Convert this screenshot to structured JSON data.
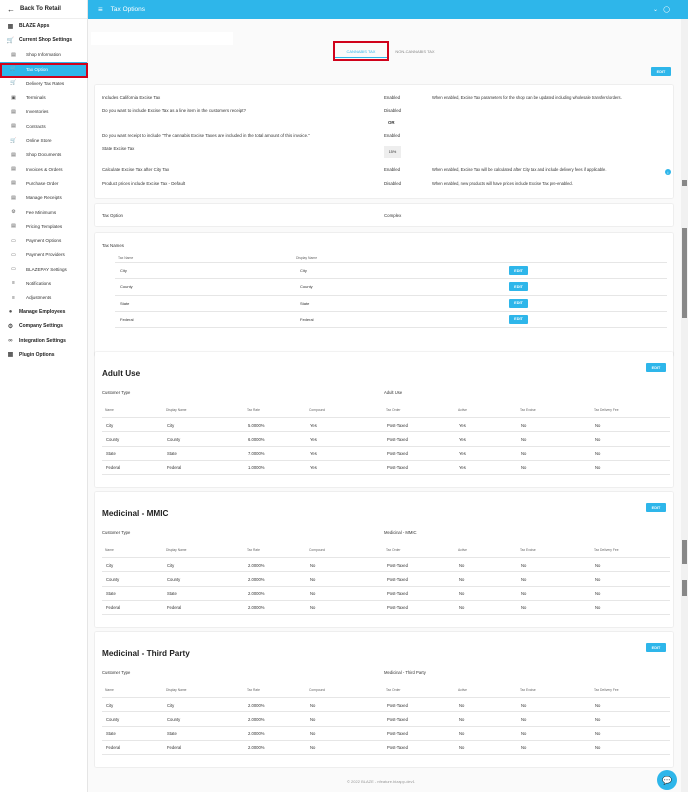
{
  "sidebar": {
    "back": "Back To Retail",
    "items": [
      {
        "label": "BLAZE Apps",
        "icon": "grid-icon",
        "glyph": "▦",
        "level": "top"
      },
      {
        "label": "Current Shop Settings",
        "icon": "cart-icon",
        "glyph": "🛒",
        "level": "top"
      },
      {
        "label": "Shop Information",
        "icon": "store-icon",
        "glyph": "▤",
        "level": "sub"
      },
      {
        "label": "Tax Option",
        "icon": "cart-icon",
        "glyph": "🛒",
        "level": "sub",
        "active": true
      },
      {
        "label": "Delivery Tax Rates",
        "icon": "cart-icon",
        "glyph": "🛒",
        "level": "sub"
      },
      {
        "label": "Terminals",
        "icon": "briefcase-icon",
        "glyph": "▣",
        "level": "sub"
      },
      {
        "label": "Inventories",
        "icon": "document-icon",
        "glyph": "▤",
        "level": "sub"
      },
      {
        "label": "Contracts",
        "icon": "document-icon",
        "glyph": "▤",
        "level": "sub"
      },
      {
        "label": "Online Store",
        "icon": "cart-icon",
        "glyph": "🛒",
        "level": "sub"
      },
      {
        "label": "Shop Documents",
        "icon": "document-icon",
        "glyph": "▤",
        "level": "sub"
      },
      {
        "label": "Invoices & Orders",
        "icon": "document-icon",
        "glyph": "▤",
        "level": "sub"
      },
      {
        "label": "Purchase Order",
        "icon": "document-icon",
        "glyph": "▤",
        "level": "sub"
      },
      {
        "label": "Manage Receipts",
        "icon": "document-icon",
        "glyph": "▤",
        "level": "sub"
      },
      {
        "label": "Fee Minimums",
        "icon": "gear-icon",
        "glyph": "⚙",
        "level": "sub"
      },
      {
        "label": "Pricing Templates",
        "icon": "document-icon",
        "glyph": "▤",
        "level": "sub"
      },
      {
        "label": "Payment Options",
        "icon": "card-icon",
        "glyph": "▭",
        "level": "sub"
      },
      {
        "label": "Payment Providers",
        "icon": "card-icon",
        "glyph": "▭",
        "level": "sub"
      },
      {
        "label": "BLAZEPAY Settings",
        "icon": "card-icon",
        "glyph": "▭",
        "level": "sub"
      },
      {
        "label": "Notifications",
        "icon": "list-icon",
        "glyph": "≡",
        "level": "sub"
      },
      {
        "label": "Adjustments",
        "icon": "list-icon",
        "glyph": "≡",
        "level": "sub"
      },
      {
        "label": "Manage Employees",
        "icon": "person-icon",
        "glyph": "●",
        "level": "top"
      },
      {
        "label": "Company Settings",
        "icon": "gear-icon",
        "glyph": "⚙",
        "level": "top"
      },
      {
        "label": "Integration Settings",
        "icon": "link-icon",
        "glyph": "∞",
        "level": "top"
      },
      {
        "label": "Plugin Options",
        "icon": "grid-icon",
        "glyph": "▦",
        "level": "top"
      }
    ]
  },
  "header": {
    "title": "Tax Options"
  },
  "tabs": [
    "CANNABIS TAX",
    "NON-CANNABIS TAX"
  ],
  "edit_label": "EDIT",
  "settings": {
    "rows": [
      {
        "label": "Includes California Excise Tax",
        "value": "Enabled",
        "desc": "When enabled, Excise Tax parameters for the shop can be updated including wholesale transfers/orders."
      },
      {
        "label": "Do you want to include Excise Tax as a line item in the customers receipt?",
        "value": "Disabled",
        "desc": ""
      },
      {
        "label": "",
        "value": "OR",
        "desc": ""
      },
      {
        "label": "Do you want receipt to include \"The cannabis Excise Taxes are included in the total amount of this invoice.\"",
        "value": "Enabled",
        "desc": ""
      },
      {
        "label": "State Excise Tax",
        "value": "15%",
        "desc": ""
      },
      {
        "label": "Calculate Excise Tax after City Tax",
        "value": "Enabled",
        "desc": "When enabled, Excise Tax will be calculated after City tax and include delivery fees if applicable."
      },
      {
        "label": "Product prices include Excise Tax - Default",
        "value": "Disabled",
        "desc": "When enabled, new products will have prices include Excise Tax pre-enabled."
      }
    ]
  },
  "tax_option": {
    "label": "Tax Option",
    "value": "Complex"
  },
  "tax_names": {
    "title": "Tax Names",
    "headers": [
      "Tax Name",
      "Display Name"
    ],
    "rows": [
      [
        "City",
        "City"
      ],
      [
        "County",
        "County"
      ],
      [
        "State",
        "State"
      ],
      [
        "Federal",
        "Federal"
      ]
    ]
  },
  "tax_tables": [
    {
      "title": "Adult Use",
      "customer_type_label": "Customer Type",
      "customer_type": "Adult Use",
      "headers": [
        "Name",
        "Display Name",
        "Tax Rate",
        "Compound",
        "Tax Order",
        "Active",
        "Tax Excise",
        "Tax Delivery Fee"
      ],
      "rows": [
        [
          "City",
          "City",
          "5.0000%",
          "Yes",
          "Post-Taxed",
          "Yes",
          "No",
          "No"
        ],
        [
          "County",
          "County",
          "6.0000%",
          "Yes",
          "Post-Taxed",
          "Yes",
          "No",
          "No"
        ],
        [
          "State",
          "State",
          "7.0000%",
          "Yes",
          "Post-Taxed",
          "Yes",
          "No",
          "No"
        ],
        [
          "Federal",
          "Federal",
          "1.0000%",
          "Yes",
          "Post-Taxed",
          "Yes",
          "No",
          "No"
        ]
      ]
    },
    {
      "title": "Medicinal - MMIC",
      "customer_type_label": "Customer Type",
      "customer_type": "Medicinal - MMIC",
      "headers": [
        "Name",
        "Display Name",
        "Tax Rate",
        "Compound",
        "Tax Order",
        "Active",
        "Tax Excise",
        "Tax Delivery Fee"
      ],
      "rows": [
        [
          "City",
          "City",
          "2.0000%",
          "No",
          "Post-Taxed",
          "No",
          "No",
          "No"
        ],
        [
          "County",
          "County",
          "2.0000%",
          "No",
          "Post-Taxed",
          "No",
          "No",
          "No"
        ],
        [
          "State",
          "State",
          "2.0000%",
          "No",
          "Post-Taxed",
          "No",
          "No",
          "No"
        ],
        [
          "Federal",
          "Federal",
          "2.0000%",
          "No",
          "Post-Taxed",
          "No",
          "No",
          "No"
        ]
      ]
    },
    {
      "title": "Medicinal - Third Party",
      "customer_type_label": "Customer Type",
      "customer_type": "Medicinal - Third Party",
      "headers": [
        "Name",
        "Display Name",
        "Tax Rate",
        "Compound",
        "Tax Order",
        "Active",
        "Tax Excise",
        "Tax Delivery Fee"
      ],
      "rows": [
        [
          "City",
          "City",
          "2.0000%",
          "No",
          "Post-Taxed",
          "No",
          "No",
          "No"
        ],
        [
          "County",
          "County",
          "2.0000%",
          "No",
          "Post-Taxed",
          "No",
          "No",
          "No"
        ],
        [
          "State",
          "State",
          "2.0000%",
          "No",
          "Post-Taxed",
          "No",
          "No",
          "No"
        ],
        [
          "Federal",
          "Federal",
          "2.0000%",
          "No",
          "Post-Taxed",
          "No",
          "No",
          "No"
        ]
      ]
    }
  ],
  "footer": "© 2022 BLAZE - nfeature.bizapp-dev1",
  "colors": {
    "accent": "#2eb6ea",
    "highlight": "#d0021b"
  }
}
